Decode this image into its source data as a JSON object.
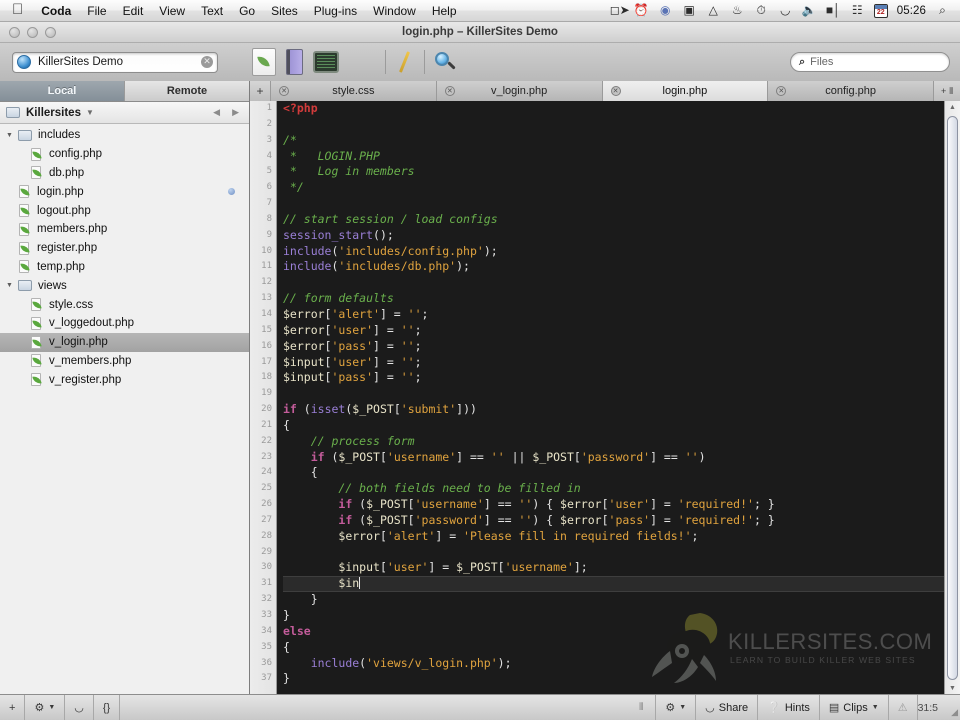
{
  "menubar": {
    "apple": "",
    "items": [
      {
        "label": "Coda",
        "bold": true
      },
      {
        "label": "File",
        "bold": false
      },
      {
        "label": "Edit",
        "bold": false
      },
      {
        "label": "View",
        "bold": false
      },
      {
        "label": "Text",
        "bold": false
      },
      {
        "label": "Go",
        "bold": false
      },
      {
        "label": "Sites",
        "bold": false
      },
      {
        "label": "Plug-ins",
        "bold": false
      },
      {
        "label": "Window",
        "bold": false
      },
      {
        "label": "Help",
        "bold": false
      }
    ],
    "status_icons": [
      "screen-recorder-icon",
      "timer-icon",
      "te-circle-icon",
      "display-icon",
      "dropbox-icon",
      "evernote-icon",
      "clock-icon",
      "wifi-icon",
      "volume-icon",
      "battery-icon",
      "sync-icon"
    ],
    "calendar_day": "22",
    "clock": "05:26",
    "spotlight": "⌕"
  },
  "window": {
    "title": "login.php – KillerSites Demo",
    "traffic_lights": [
      "close-button",
      "minimize-button",
      "zoom-button"
    ]
  },
  "toolbar": {
    "site_name": "KillerSites Demo",
    "clear_glyph": "✕",
    "icons": [
      "new-file-icon",
      "books-icon",
      "terminal-icon",
      "edit-mode-icon",
      "preview-mode-icon"
    ],
    "search": {
      "placeholder": "Files",
      "value": "",
      "icon": "search-icon"
    }
  },
  "sidebar": {
    "local_label": "Local",
    "remote_label": "Remote",
    "active_pane": "Local",
    "site_root": "Killersites",
    "nav_prev": "◀",
    "nav_next": "▶",
    "tree": [
      {
        "name": "includes",
        "type": "folder",
        "depth": 0,
        "expanded": true,
        "selected": false,
        "modified": false
      },
      {
        "name": "config.php",
        "type": "file",
        "depth": 1,
        "expanded": false,
        "selected": false,
        "modified": false
      },
      {
        "name": "db.php",
        "type": "file",
        "depth": 1,
        "expanded": false,
        "selected": false,
        "modified": false
      },
      {
        "name": "login.php",
        "type": "file",
        "depth": 0,
        "expanded": false,
        "selected": false,
        "modified": true
      },
      {
        "name": "logout.php",
        "type": "file",
        "depth": 0,
        "expanded": false,
        "selected": false,
        "modified": false
      },
      {
        "name": "members.php",
        "type": "file",
        "depth": 0,
        "expanded": false,
        "selected": false,
        "modified": false
      },
      {
        "name": "register.php",
        "type": "file",
        "depth": 0,
        "expanded": false,
        "selected": false,
        "modified": false
      },
      {
        "name": "temp.php",
        "type": "file",
        "depth": 0,
        "expanded": false,
        "selected": false,
        "modified": false
      },
      {
        "name": "views",
        "type": "folder",
        "depth": 0,
        "expanded": true,
        "selected": false,
        "modified": false
      },
      {
        "name": "style.css",
        "type": "file",
        "depth": 1,
        "expanded": false,
        "selected": false,
        "modified": false
      },
      {
        "name": "v_loggedout.php",
        "type": "file",
        "depth": 1,
        "expanded": false,
        "selected": false,
        "modified": false
      },
      {
        "name": "v_login.php",
        "type": "file",
        "depth": 1,
        "expanded": false,
        "selected": true,
        "modified": false
      },
      {
        "name": "v_members.php",
        "type": "file",
        "depth": 1,
        "expanded": false,
        "selected": false,
        "modified": false
      },
      {
        "name": "v_register.php",
        "type": "file",
        "depth": 1,
        "expanded": false,
        "selected": false,
        "modified": false
      }
    ]
  },
  "tabs": {
    "new_tab_glyph": "+",
    "close_glyph": "✕",
    "split_glyph": "⫴",
    "items": [
      {
        "label": "style.css",
        "active": false
      },
      {
        "label": "v_login.php",
        "active": false
      },
      {
        "label": "login.php",
        "active": true
      },
      {
        "label": "config.php",
        "active": false
      }
    ]
  },
  "editor": {
    "language": "PHP",
    "cursor_line": 31,
    "lines": [
      {
        "n": 1,
        "tokens": [
          {
            "t": "<?php",
            "c": "php"
          }
        ]
      },
      {
        "n": 2,
        "tokens": []
      },
      {
        "n": 3,
        "tokens": [
          {
            "t": "/*",
            "c": "cm"
          }
        ]
      },
      {
        "n": 4,
        "tokens": [
          {
            "t": " *   LOGIN.PHP",
            "c": "cm"
          }
        ]
      },
      {
        "n": 5,
        "tokens": [
          {
            "t": " *   Log in members",
            "c": "cm"
          }
        ]
      },
      {
        "n": 6,
        "tokens": [
          {
            "t": " */",
            "c": "cm"
          }
        ]
      },
      {
        "n": 7,
        "tokens": []
      },
      {
        "n": 8,
        "tokens": [
          {
            "t": "// start session / load configs",
            "c": "cm"
          }
        ]
      },
      {
        "n": 9,
        "tokens": [
          {
            "t": "session_start",
            "c": "fn"
          },
          {
            "t": "();",
            "c": "pn"
          }
        ]
      },
      {
        "n": 10,
        "tokens": [
          {
            "t": "include",
            "c": "fn"
          },
          {
            "t": "(",
            "c": "pn"
          },
          {
            "t": "'includes/config.php'",
            "c": "str"
          },
          {
            "t": ");",
            "c": "pn"
          }
        ]
      },
      {
        "n": 11,
        "tokens": [
          {
            "t": "include",
            "c": "fn"
          },
          {
            "t": "(",
            "c": "pn"
          },
          {
            "t": "'includes/db.php'",
            "c": "str"
          },
          {
            "t": ");",
            "c": "pn"
          }
        ]
      },
      {
        "n": 12,
        "tokens": []
      },
      {
        "n": 13,
        "tokens": [
          {
            "t": "// form defaults",
            "c": "cm"
          }
        ]
      },
      {
        "n": 14,
        "tokens": [
          {
            "t": "$error",
            "c": "var"
          },
          {
            "t": "[",
            "c": "pn"
          },
          {
            "t": "'alert'",
            "c": "str"
          },
          {
            "t": "] = ",
            "c": "pn"
          },
          {
            "t": "''",
            "c": "str"
          },
          {
            "t": ";",
            "c": "pn"
          }
        ]
      },
      {
        "n": 15,
        "tokens": [
          {
            "t": "$error",
            "c": "var"
          },
          {
            "t": "[",
            "c": "pn"
          },
          {
            "t": "'user'",
            "c": "str"
          },
          {
            "t": "] = ",
            "c": "pn"
          },
          {
            "t": "''",
            "c": "str"
          },
          {
            "t": ";",
            "c": "pn"
          }
        ]
      },
      {
        "n": 16,
        "tokens": [
          {
            "t": "$error",
            "c": "var"
          },
          {
            "t": "[",
            "c": "pn"
          },
          {
            "t": "'pass'",
            "c": "str"
          },
          {
            "t": "] = ",
            "c": "pn"
          },
          {
            "t": "''",
            "c": "str"
          },
          {
            "t": ";",
            "c": "pn"
          }
        ]
      },
      {
        "n": 17,
        "tokens": [
          {
            "t": "$input",
            "c": "var"
          },
          {
            "t": "[",
            "c": "pn"
          },
          {
            "t": "'user'",
            "c": "str"
          },
          {
            "t": "] = ",
            "c": "pn"
          },
          {
            "t": "''",
            "c": "str"
          },
          {
            "t": ";",
            "c": "pn"
          }
        ]
      },
      {
        "n": 18,
        "tokens": [
          {
            "t": "$input",
            "c": "var"
          },
          {
            "t": "[",
            "c": "pn"
          },
          {
            "t": "'pass'",
            "c": "str"
          },
          {
            "t": "] = ",
            "c": "pn"
          },
          {
            "t": "''",
            "c": "str"
          },
          {
            "t": ";",
            "c": "pn"
          }
        ]
      },
      {
        "n": 19,
        "tokens": []
      },
      {
        "n": 20,
        "tokens": [
          {
            "t": "if",
            "c": "kw"
          },
          {
            "t": " (",
            "c": "pn"
          },
          {
            "t": "isset",
            "c": "fn"
          },
          {
            "t": "(",
            "c": "pn"
          },
          {
            "t": "$_POST",
            "c": "var"
          },
          {
            "t": "[",
            "c": "pn"
          },
          {
            "t": "'submit'",
            "c": "str"
          },
          {
            "t": "]))",
            "c": "pn"
          }
        ]
      },
      {
        "n": 21,
        "tokens": [
          {
            "t": "{",
            "c": "pn"
          }
        ]
      },
      {
        "n": 22,
        "tokens": [
          {
            "t": "    // process form",
            "c": "cm"
          }
        ]
      },
      {
        "n": 23,
        "tokens": [
          {
            "t": "    ",
            "c": "pn"
          },
          {
            "t": "if",
            "c": "kw"
          },
          {
            "t": " (",
            "c": "pn"
          },
          {
            "t": "$_POST",
            "c": "var"
          },
          {
            "t": "[",
            "c": "pn"
          },
          {
            "t": "'username'",
            "c": "str"
          },
          {
            "t": "] == ",
            "c": "pn"
          },
          {
            "t": "''",
            "c": "str"
          },
          {
            "t": " || ",
            "c": "pn"
          },
          {
            "t": "$_POST",
            "c": "var"
          },
          {
            "t": "[",
            "c": "pn"
          },
          {
            "t": "'password'",
            "c": "str"
          },
          {
            "t": "] == ",
            "c": "pn"
          },
          {
            "t": "''",
            "c": "str"
          },
          {
            "t": ")",
            "c": "pn"
          }
        ]
      },
      {
        "n": 24,
        "tokens": [
          {
            "t": "    {",
            "c": "pn"
          }
        ]
      },
      {
        "n": 25,
        "tokens": [
          {
            "t": "        // both fields need to be filled in",
            "c": "cm"
          }
        ]
      },
      {
        "n": 26,
        "tokens": [
          {
            "t": "        ",
            "c": "pn"
          },
          {
            "t": "if",
            "c": "kw"
          },
          {
            "t": " (",
            "c": "pn"
          },
          {
            "t": "$_POST",
            "c": "var"
          },
          {
            "t": "[",
            "c": "pn"
          },
          {
            "t": "'username'",
            "c": "str"
          },
          {
            "t": "] == ",
            "c": "pn"
          },
          {
            "t": "''",
            "c": "str"
          },
          {
            "t": ") { ",
            "c": "pn"
          },
          {
            "t": "$error",
            "c": "var"
          },
          {
            "t": "[",
            "c": "pn"
          },
          {
            "t": "'user'",
            "c": "str"
          },
          {
            "t": "] = ",
            "c": "pn"
          },
          {
            "t": "'required!'",
            "c": "str"
          },
          {
            "t": "; }",
            "c": "pn"
          }
        ]
      },
      {
        "n": 27,
        "tokens": [
          {
            "t": "        ",
            "c": "pn"
          },
          {
            "t": "if",
            "c": "kw"
          },
          {
            "t": " (",
            "c": "pn"
          },
          {
            "t": "$_POST",
            "c": "var"
          },
          {
            "t": "[",
            "c": "pn"
          },
          {
            "t": "'password'",
            "c": "str"
          },
          {
            "t": "] == ",
            "c": "pn"
          },
          {
            "t": "''",
            "c": "str"
          },
          {
            "t": ") { ",
            "c": "pn"
          },
          {
            "t": "$error",
            "c": "var"
          },
          {
            "t": "[",
            "c": "pn"
          },
          {
            "t": "'pass'",
            "c": "str"
          },
          {
            "t": "] = ",
            "c": "pn"
          },
          {
            "t": "'required!'",
            "c": "str"
          },
          {
            "t": "; }",
            "c": "pn"
          }
        ]
      },
      {
        "n": 28,
        "tokens": [
          {
            "t": "        ",
            "c": "pn"
          },
          {
            "t": "$error",
            "c": "var"
          },
          {
            "t": "[",
            "c": "pn"
          },
          {
            "t": "'alert'",
            "c": "str"
          },
          {
            "t": "] = ",
            "c": "pn"
          },
          {
            "t": "'Please fill in required fields!'",
            "c": "str"
          },
          {
            "t": ";",
            "c": "pn"
          }
        ]
      },
      {
        "n": 29,
        "tokens": []
      },
      {
        "n": 30,
        "tokens": [
          {
            "t": "        ",
            "c": "pn"
          },
          {
            "t": "$input",
            "c": "var"
          },
          {
            "t": "[",
            "c": "pn"
          },
          {
            "t": "'user'",
            "c": "str"
          },
          {
            "t": "] = ",
            "c": "pn"
          },
          {
            "t": "$_POST",
            "c": "var"
          },
          {
            "t": "[",
            "c": "pn"
          },
          {
            "t": "'username'",
            "c": "str"
          },
          {
            "t": "];",
            "c": "pn"
          }
        ]
      },
      {
        "n": 31,
        "tokens": [
          {
            "t": "        ",
            "c": "pn"
          },
          {
            "t": "$in",
            "c": "var"
          }
        ],
        "cursor": true,
        "highlight": true
      },
      {
        "n": 32,
        "tokens": [
          {
            "t": "    }",
            "c": "pn"
          }
        ]
      },
      {
        "n": 33,
        "tokens": [
          {
            "t": "}",
            "c": "pn"
          }
        ]
      },
      {
        "n": 34,
        "tokens": [
          {
            "t": "else",
            "c": "kw"
          }
        ]
      },
      {
        "n": 35,
        "tokens": [
          {
            "t": "{",
            "c": "pn"
          }
        ]
      },
      {
        "n": 36,
        "tokens": [
          {
            "t": "    ",
            "c": "pn"
          },
          {
            "t": "include",
            "c": "fn"
          },
          {
            "t": "(",
            "c": "pn"
          },
          {
            "t": "'views/v_login.php'",
            "c": "str"
          },
          {
            "t": ");",
            "c": "pn"
          }
        ]
      },
      {
        "n": 37,
        "tokens": [
          {
            "t": "}",
            "c": "pn"
          }
        ]
      }
    ],
    "watermark": {
      "title": "KILLERSITES.COM",
      "tagline": "LEARN TO BUILD KILLER WEB SITES"
    },
    "scrollbar": {
      "up": "▲",
      "down": "▼"
    }
  },
  "statusbar": {
    "left_items": [
      {
        "label": "",
        "icon": "plus-icon"
      },
      {
        "label": "",
        "icon": "gear-icon"
      },
      {
        "label": "",
        "icon": "wifi-icon"
      },
      {
        "label": "",
        "icon": "braces-icon"
      }
    ],
    "right_items": [
      {
        "label": "",
        "icon": "gear-icon"
      },
      {
        "label": "Share",
        "icon": "share-icon"
      },
      {
        "label": "Hints",
        "icon": "help-icon"
      },
      {
        "label": "Clips",
        "icon": "clips-icon"
      },
      {
        "label": "",
        "icon": "warning-icon"
      }
    ],
    "grip": "⦀",
    "line_col": "31:5",
    "resize": "◢"
  },
  "colors": {
    "editor_bg": "#1b1b1b",
    "php_tag": "#d23b3b",
    "comment": "#6ab04c",
    "string": "#e0a33e",
    "keyword": "#c45c9b",
    "function": "#9a7fd6",
    "variable": "#e8e3c8",
    "selection": "#a8a8a8"
  }
}
